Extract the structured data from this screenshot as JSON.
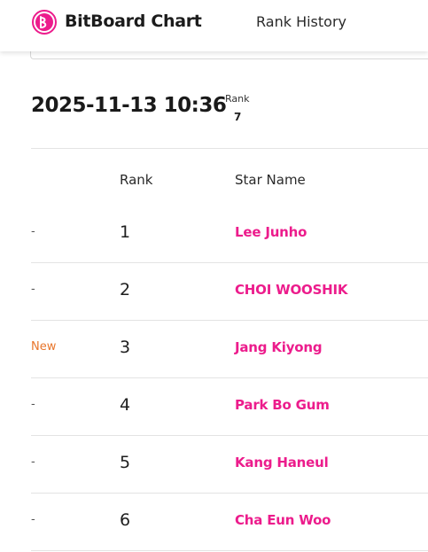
{
  "header": {
    "brand": "BitBoard Chart",
    "logo_icon": "bitboard-logo-icon",
    "nav_link": "Rank History"
  },
  "summary": {
    "datetime": "2025-11-13 10:36",
    "rank_label": "Rank",
    "rank_value": "7"
  },
  "table": {
    "columns": [
      "",
      "Rank",
      "Star Name"
    ],
    "rows": [
      {
        "change": "-",
        "rank": "1",
        "name": "Lee Junho"
      },
      {
        "change": "-",
        "rank": "2",
        "name": "CHOI WOOSHIK"
      },
      {
        "change": "New",
        "rank": "3",
        "name": "Jang Kiyong"
      },
      {
        "change": "-",
        "rank": "4",
        "name": "Park Bo Gum"
      },
      {
        "change": "-",
        "rank": "5",
        "name": "Kang Haneul"
      },
      {
        "change": "-",
        "rank": "6",
        "name": "Cha Eun Woo"
      }
    ]
  },
  "colors": {
    "accent": "#ec1c8c",
    "new_badge": "#e8762c"
  }
}
